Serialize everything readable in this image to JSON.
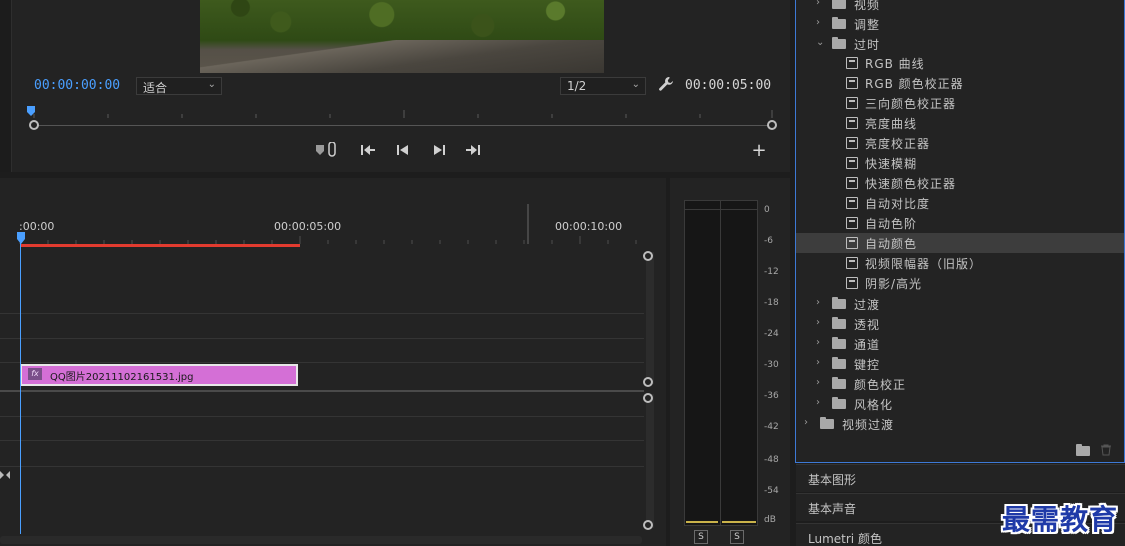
{
  "monitor": {
    "current_timecode": "00:00:00:00",
    "zoom_value": "适合",
    "resolution_value": "1/2",
    "duration_timecode": "00:00:05:00",
    "add_button": "+"
  },
  "timeline": {
    "ruler_labels": [
      ":00:00",
      "00:00:05:00",
      "00:00:10:00"
    ],
    "clip": {
      "badge": "fx",
      "name": "QQ图片20211102161531.jpg"
    }
  },
  "meters": {
    "db_labels": [
      "0",
      "-6",
      "-12",
      "-18",
      "-24",
      "-30",
      "-36",
      "-42",
      "-48",
      "-54",
      "dB"
    ],
    "solo_left": "S",
    "solo_right": "S"
  },
  "effects": {
    "items": [
      {
        "label": "视频",
        "kind": "folder",
        "state": "collapsed"
      },
      {
        "label": "调整",
        "kind": "folder",
        "state": "collapsed"
      },
      {
        "label": "过时",
        "kind": "folder",
        "state": "expanded"
      },
      {
        "label": "RGB 曲线",
        "kind": "effect"
      },
      {
        "label": "RGB 颜色校正器",
        "kind": "effect"
      },
      {
        "label": "三向颜色校正器",
        "kind": "effect"
      },
      {
        "label": "亮度曲线",
        "kind": "effect"
      },
      {
        "label": "亮度校正器",
        "kind": "effect"
      },
      {
        "label": "快速模糊",
        "kind": "effect"
      },
      {
        "label": "快速颜色校正器",
        "kind": "effect"
      },
      {
        "label": "自动对比度",
        "kind": "effect"
      },
      {
        "label": "自动色阶",
        "kind": "effect"
      },
      {
        "label": "自动颜色",
        "kind": "effect",
        "selected": true
      },
      {
        "label": "视频限幅器（旧版）",
        "kind": "effect"
      },
      {
        "label": "阴影/高光",
        "kind": "effect"
      },
      {
        "label": "过渡",
        "kind": "folder",
        "state": "collapsed"
      },
      {
        "label": "透视",
        "kind": "folder",
        "state": "collapsed"
      },
      {
        "label": "通道",
        "kind": "folder",
        "state": "collapsed"
      },
      {
        "label": "键控",
        "kind": "folder",
        "state": "collapsed"
      },
      {
        "label": "颜色校正",
        "kind": "folder",
        "state": "collapsed"
      },
      {
        "label": "风格化",
        "kind": "folder",
        "state": "collapsed"
      },
      {
        "label": "视频过渡",
        "kind": "folder",
        "state": "collapsed",
        "top_level": true
      }
    ]
  },
  "panels": {
    "essential_graphics": "基本图形",
    "essential_sound": "基本声音",
    "lumetri": "Lumetri 颜色"
  },
  "watermark": "最需教育",
  "colors": {
    "accent_blue": "#4a9fff",
    "inout_red": "#e23b2f",
    "clip_pink": "#d46fd6",
    "selected_row": "#3d3d3d",
    "panel_focus_border": "#3d79d6"
  }
}
